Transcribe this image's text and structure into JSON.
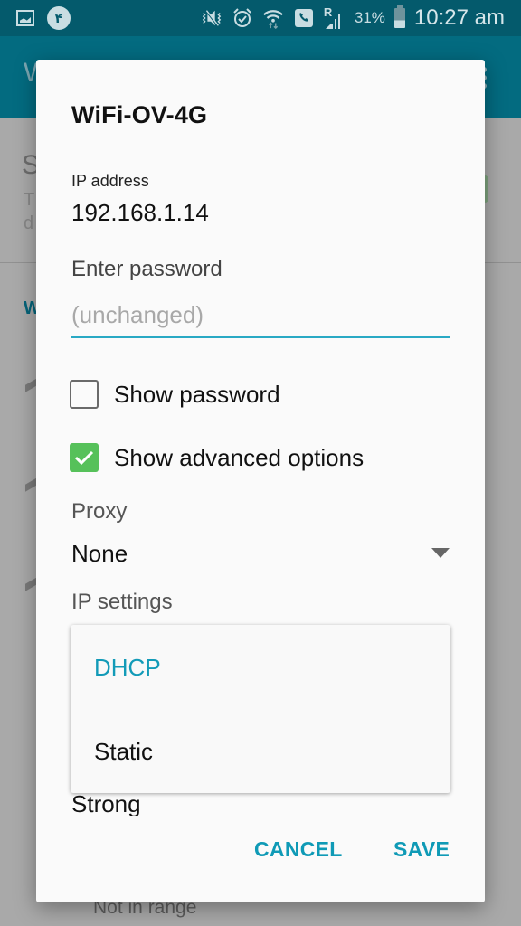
{
  "status_bar": {
    "left_icons": [
      "gallery-icon",
      "notification-f-icon"
    ],
    "notification_badge": "۴",
    "right_icons": [
      "mute-vibrate-icon",
      "alarm-icon",
      "wifi-icon",
      "call-icon",
      "signal-roaming-icon",
      "battery-icon"
    ],
    "roaming_label": "R",
    "battery_percent": "31%",
    "time": "10:27 am"
  },
  "app_bar": {
    "title_partial": "W"
  },
  "background": {
    "section_header_partial": "S",
    "section_desc_partial": [
      "T",
      "d"
    ],
    "list_header_partial": "W",
    "not_in_range": "Not in range"
  },
  "dialog": {
    "title": "WiFi-OV-4G",
    "ip_label": "IP address",
    "ip_value": "192.168.1.14",
    "password_label": "Enter password",
    "password_value": "",
    "password_placeholder": "(unchanged)",
    "show_password": {
      "label": "Show password",
      "checked": false
    },
    "show_advanced": {
      "label": "Show advanced options",
      "checked": true
    },
    "proxy_label": "Proxy",
    "proxy_value": "None",
    "ip_settings_label": "IP settings",
    "ip_settings_options": [
      {
        "label": "DHCP",
        "selected": true
      },
      {
        "label": "Static",
        "selected": false
      }
    ],
    "signal_strength_partial": "Strong",
    "cancel_label": "CANCEL",
    "save_label": "SAVE"
  },
  "colors": {
    "status_bar": "#045a6c",
    "app_bar": "#036b80",
    "accent": "#0f9ab6",
    "checkbox_checked": "#56c15a",
    "input_underline": "#29a9c4"
  }
}
